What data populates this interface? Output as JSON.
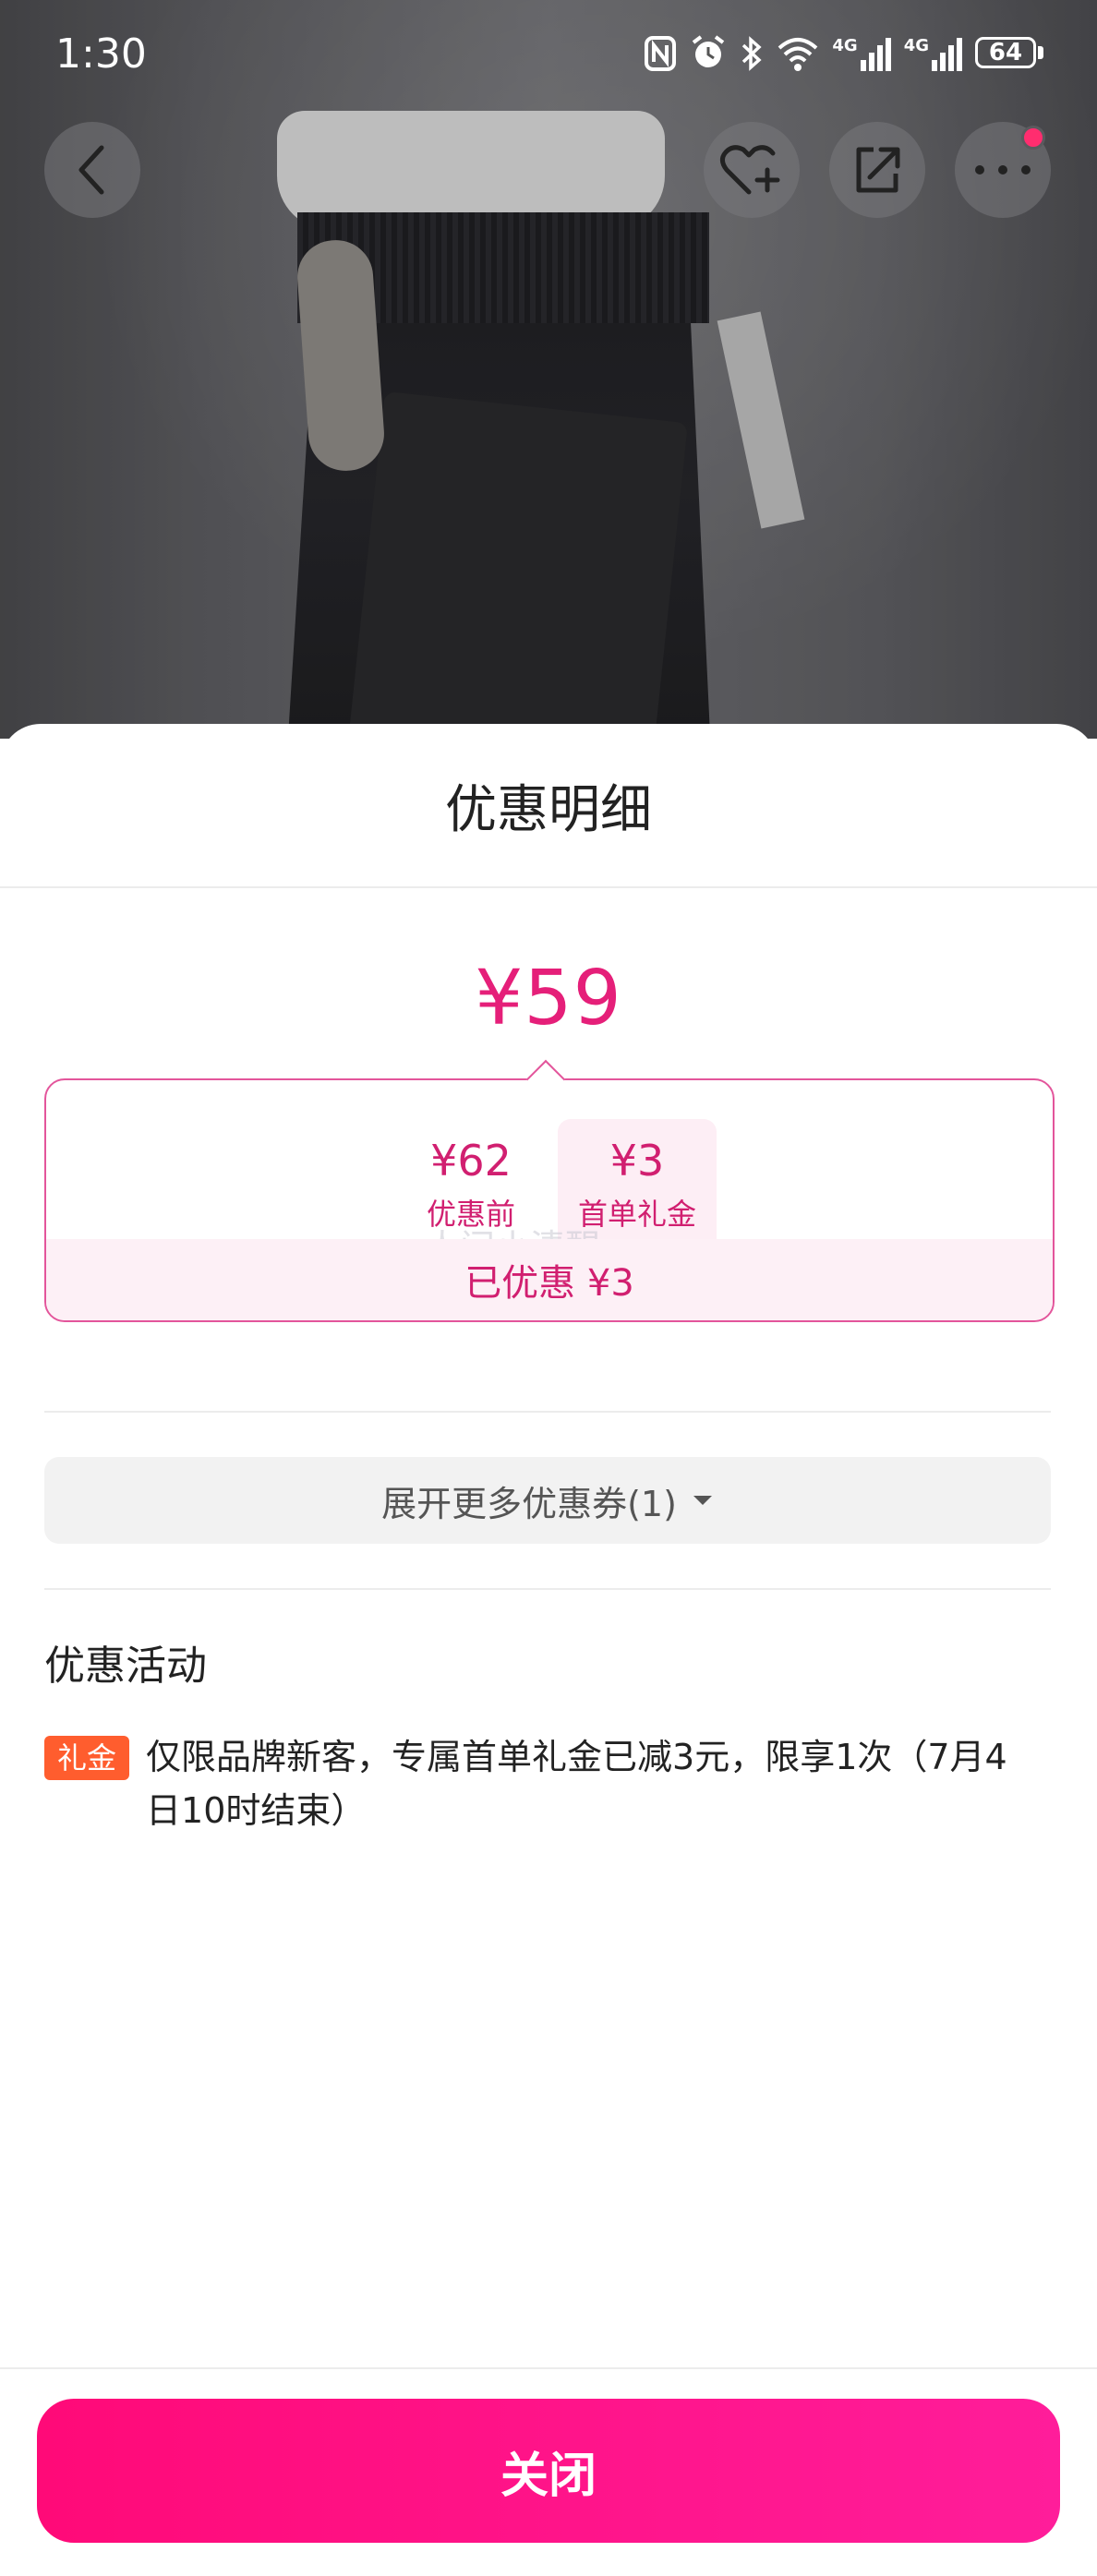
{
  "status_bar": {
    "time": "1:30",
    "battery": "64",
    "network_1": "4G",
    "network_2": "4G"
  },
  "nav": {
    "icons": [
      "back-icon",
      "favorite-add-icon",
      "share-icon",
      "more-icon"
    ]
  },
  "sheet": {
    "title": "优惠明细",
    "final_price": "¥59",
    "original": {
      "amount": "¥62",
      "label": "优惠前"
    },
    "minus": "-",
    "gift": {
      "amount": "¥3",
      "label": "首单礼金"
    },
    "watermark": "人间小清醒",
    "saved": "已优惠 ¥3",
    "expand_label": "展开更多优惠券(1)",
    "activities_title": "优惠活动",
    "activity": {
      "badge": "礼金",
      "text": "仅限品牌新客，专属首单礼金已减3元，限享1次（7月4日10时结束）"
    },
    "close_label": "关闭"
  },
  "colors": {
    "accent": "#e51f79",
    "button_start": "#ff0a78",
    "button_end": "#ff1d9a",
    "badge": "#ff5d2e"
  }
}
